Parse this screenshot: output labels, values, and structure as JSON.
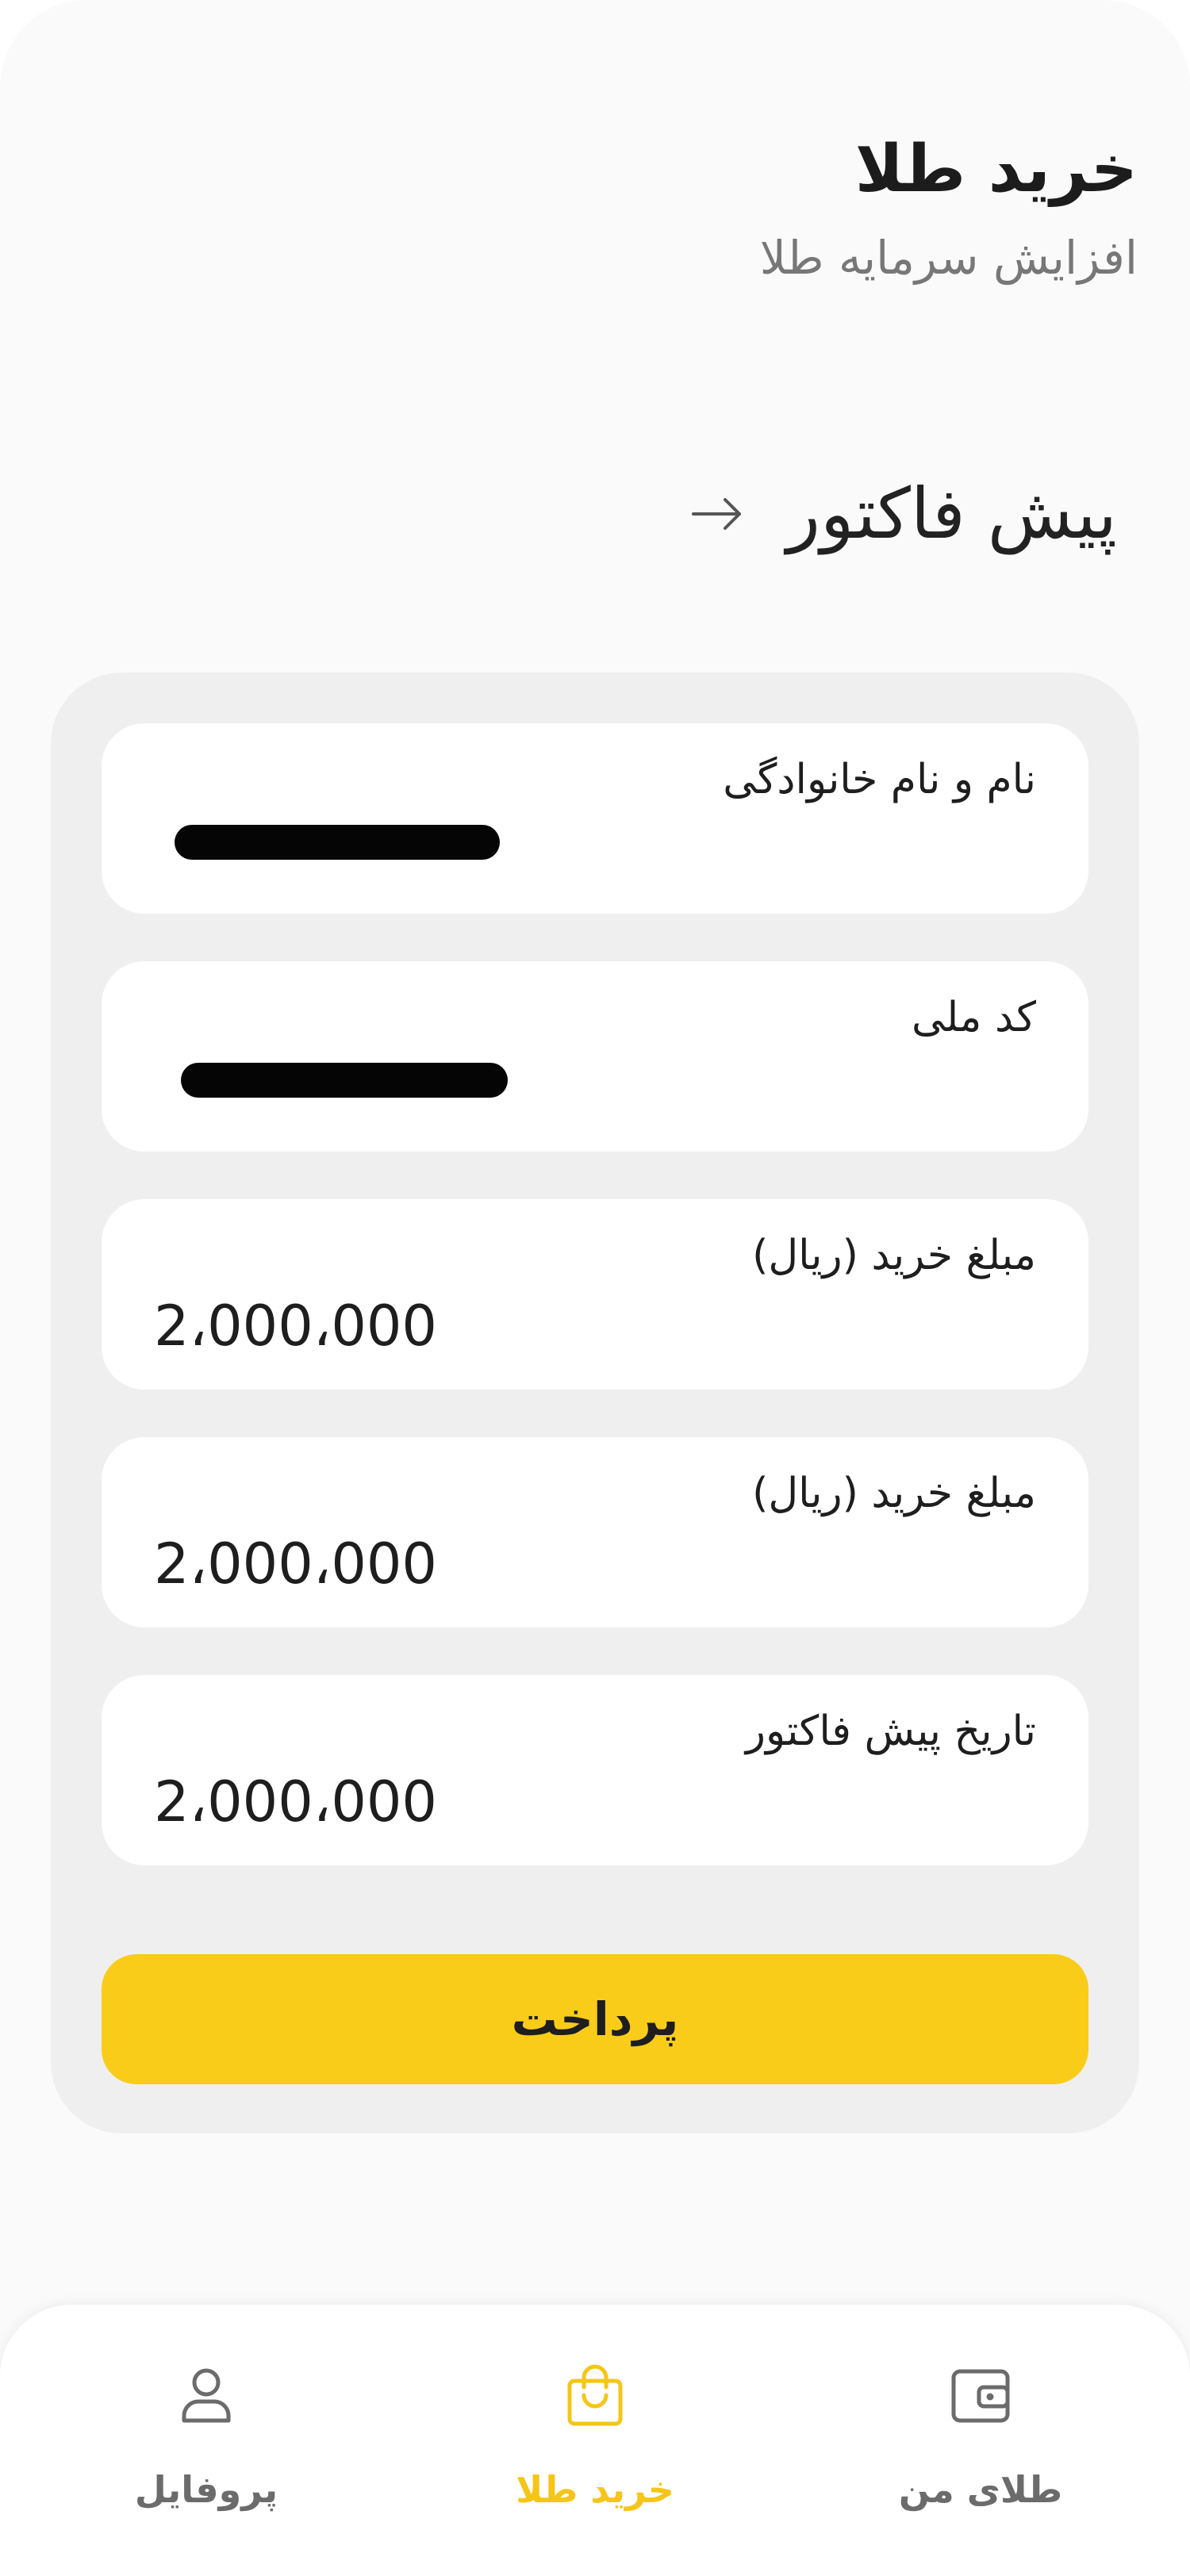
{
  "header": {
    "title": "خرید طلا",
    "subtitle": "افزایش سرمایه طلا"
  },
  "section": {
    "title": "پیش فاکتور",
    "back_icon": "arrow-right-icon"
  },
  "invoice": {
    "fields": [
      {
        "label": "نام و نام خانوادگی",
        "value": "",
        "redacted": true
      },
      {
        "label": "کد ملی",
        "value": "",
        "redacted": true
      },
      {
        "label": "مبلغ خرید (ریال)",
        "value": "2،000،000"
      },
      {
        "label": "مبلغ خرید (ریال)",
        "value": "2،000،000"
      },
      {
        "label": "تاریخ پیش فاکتور",
        "value": "2،000،000"
      }
    ],
    "pay_label": "پرداخت"
  },
  "nav": {
    "items": [
      {
        "label": "طلای من",
        "icon": "wallet-icon",
        "active": false
      },
      {
        "label": "خرید طلا",
        "icon": "shopping-bag-icon",
        "active": true
      },
      {
        "label": "پروفایل",
        "icon": "user-icon",
        "active": false
      }
    ]
  },
  "colors": {
    "accent": "#f9cc1a",
    "nav_active": "#f5c518",
    "nav_inactive": "#6b6b6b",
    "background": "#fafafa",
    "panel": "#efefef"
  }
}
